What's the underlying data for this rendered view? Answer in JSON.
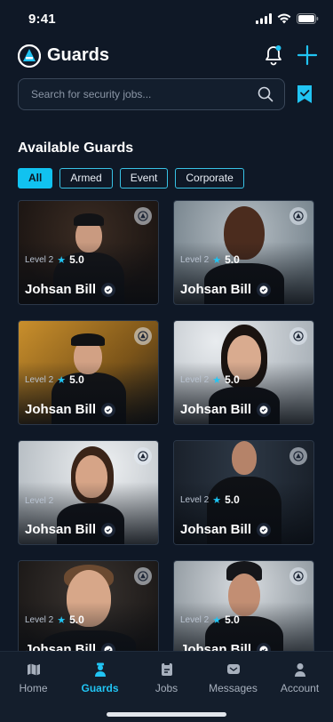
{
  "status": {
    "time": "9:41"
  },
  "header": {
    "title": "Guards"
  },
  "search": {
    "placeholder": "Search for security jobs..."
  },
  "section": {
    "title": "Available Guards"
  },
  "filters": [
    {
      "label": "All",
      "active": true
    },
    {
      "label": "Armed",
      "active": false
    },
    {
      "label": "Event",
      "active": false
    },
    {
      "label": "Corporate",
      "active": false
    }
  ],
  "guards": [
    {
      "level": "Level 2",
      "rating": "5.0",
      "name": "Johsan Bill",
      "verified": true
    },
    {
      "level": "Level 2",
      "rating": "5.0",
      "name": "Johsan Bill",
      "verified": true
    },
    {
      "level": "Level 2",
      "rating": "5.0",
      "name": "Johsan Bill",
      "verified": true
    },
    {
      "level": "Level 2",
      "rating": "5.0",
      "name": "Johsan Bill",
      "verified": true
    },
    {
      "level": "Level 2",
      "rating": "",
      "name": "Johsan Bill",
      "verified": true
    },
    {
      "level": "Level 2",
      "rating": "5.0",
      "name": "Johsan Bill",
      "verified": true
    },
    {
      "level": "Level 2",
      "rating": "5.0",
      "name": "Johsan Bill",
      "verified": true
    },
    {
      "level": "Level 2",
      "rating": "5.0",
      "name": "Johsan Bill",
      "verified": true
    }
  ],
  "tabs": [
    {
      "label": "Home",
      "icon": "map-icon",
      "active": false
    },
    {
      "label": "Guards",
      "icon": "guard-icon",
      "active": true
    },
    {
      "label": "Jobs",
      "icon": "jobs-icon",
      "active": false
    },
    {
      "label": "Messages",
      "icon": "messages-icon",
      "active": false
    },
    {
      "label": "Account",
      "icon": "account-icon",
      "active": false
    }
  ],
  "colors": {
    "accent": "#21c4f3",
    "background": "#0f1826",
    "tabbar": "#141e2c"
  }
}
